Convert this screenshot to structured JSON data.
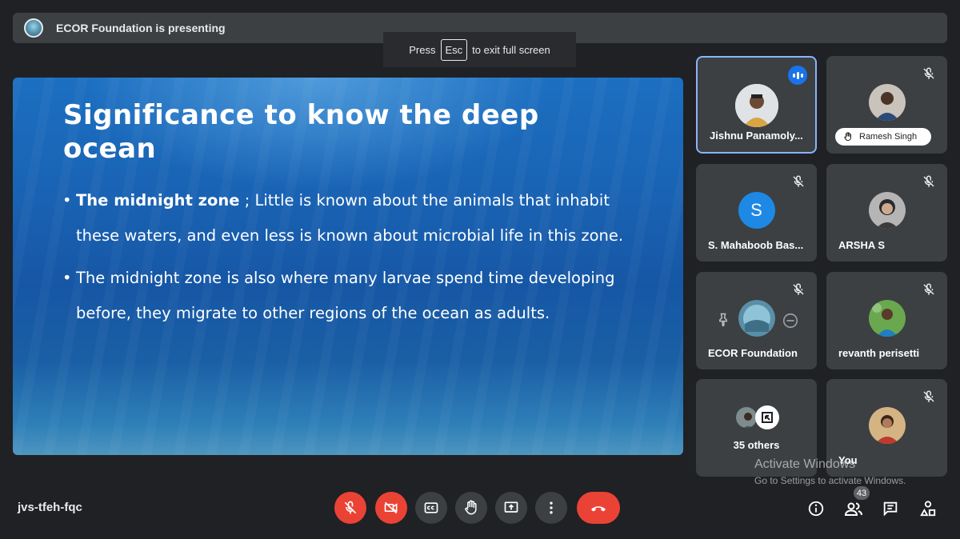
{
  "presenting": {
    "text": "ECOR Foundation is presenting"
  },
  "esc_hint": {
    "press": "Press",
    "key": "Esc",
    "suffix": "to exit full screen"
  },
  "slide": {
    "title": "Significance to know the deep ocean",
    "bullets": [
      {
        "bold": "The midnight zone",
        "text": " ; Little is known about the animals that inhabit these waters, and even less is known about microbial life in this zone."
      },
      {
        "bold": "",
        "text": "The midnight zone is also where many larvae spend time developing before, they migrate to other regions of the ocean as adults."
      }
    ]
  },
  "participants": [
    {
      "name": "Jishnu Panamoly...",
      "speaking": true,
      "muted": false
    },
    {
      "name": "Ramesh Singh",
      "muted": true,
      "hand_raised": true
    },
    {
      "name": "S. Mahaboob Bas...",
      "initial": "S",
      "muted": true
    },
    {
      "name": "ARSHA S",
      "muted": true
    },
    {
      "name": "ECOR Foundation",
      "muted": true
    },
    {
      "name": "revanth perisetti",
      "muted": true
    },
    {
      "name": "35 others"
    },
    {
      "name": "You",
      "muted": true
    }
  ],
  "meeting_code": "jvs-tfeh-fqc",
  "people_count": "43",
  "watermark": {
    "line1": "Activate Windows",
    "line2": "Go to Settings to activate Windows."
  },
  "colors": {
    "background": "#202124",
    "danger": "#ea4335",
    "active_border": "#8ab4f8",
    "speaking": "#1a73e8"
  },
  "icons": [
    "mic-off-icon",
    "camera-off-icon",
    "captions-icon",
    "raise-hand-icon",
    "present-icon",
    "more-options-icon",
    "end-call-icon",
    "info-icon",
    "people-icon",
    "chat-icon",
    "activities-icon",
    "pin-icon",
    "remove-icon"
  ]
}
